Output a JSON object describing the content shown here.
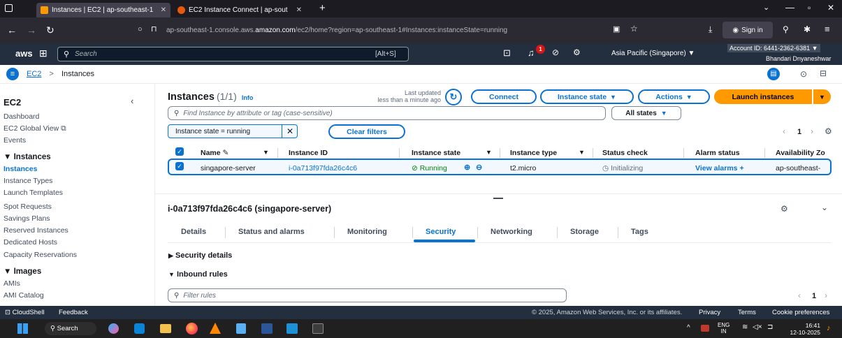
{
  "browser": {
    "tabs": [
      {
        "title": "Instances | EC2 | ap-southeast-1",
        "active": true
      },
      {
        "title": "EC2 Instance Connect | ap-sout",
        "active": false
      }
    ],
    "url_prefix": "ap-southeast-1.console.aws.",
    "url_domain": "amazon.com",
    "url_suffix": "/ec2/home?region=ap-southeast-1#Instances:instanceState=running",
    "sign_in": "Sign in"
  },
  "aws_nav": {
    "logo": "aws",
    "search_placeholder": "Search",
    "shortcut": "[Alt+S]",
    "notification_count": "1",
    "region": "Asia Pacific (Singapore) ▼",
    "account_id": "Account ID: 6441-2362-6381 ▼",
    "user": "Bhandari Dnyaneshwar"
  },
  "breadcrumb": {
    "service": "EC2",
    "separator": ">",
    "page": "Instances"
  },
  "sidebar": {
    "title": "EC2",
    "top_items": [
      "Dashboard",
      "EC2 Global View",
      "Events"
    ],
    "sections": [
      {
        "title": "Instances",
        "items": [
          "Instances",
          "Instance Types",
          "Launch Templates",
          "Spot Requests",
          "Savings Plans",
          "Reserved Instances",
          "Dedicated Hosts",
          "Capacity Reservations"
        ]
      },
      {
        "title": "Images",
        "items": [
          "AMIs",
          "AMI Catalog"
        ]
      }
    ]
  },
  "instances": {
    "title": "Instances",
    "count": "(1/1)",
    "info": "Info",
    "last_updated_label": "Last updated",
    "last_updated_value": "less than a minute ago",
    "connect": "Connect",
    "instance_state_btn": "Instance state",
    "actions_btn": "Actions",
    "launch_btn": "Launch instances",
    "search_placeholder": "Find Instance by attribute or tag (case-sensitive)",
    "states_filter": "All states",
    "filter_token": "Instance state = running",
    "clear_filters": "Clear filters",
    "page_number": "1",
    "columns": [
      "Name",
      "Instance ID",
      "Instance state",
      "Instance type",
      "Status check",
      "Alarm status",
      "Availability Zo"
    ],
    "row": {
      "name": "singapore-server",
      "id": "i-0a713f97fda26c4c6",
      "state": "Running",
      "type": "t2.micro",
      "status": "Initializing",
      "alarm": "View alarms",
      "az": "ap-southeast-"
    }
  },
  "details": {
    "title": "i-0a713f97fda26c4c6 (singapore-server)",
    "tabs": [
      "Details",
      "Status and alarms",
      "Monitoring",
      "Security",
      "Networking",
      "Storage",
      "Tags"
    ],
    "active_tab": "Security",
    "security_details": "Security details",
    "inbound_rules": "Inbound rules",
    "filter_placeholder": "Filter rules",
    "page_number": "1"
  },
  "footer": {
    "cloudshell": "CloudShell",
    "feedback": "Feedback",
    "copyright": "© 2025, Amazon Web Services, Inc. or its affiliates.",
    "privacy": "Privacy",
    "terms": "Terms",
    "cookies": "Cookie preferences"
  },
  "taskbar": {
    "search": "Search",
    "lang_top": "ENG",
    "lang_bottom": "IN",
    "time": "16:41",
    "date": "12-10-2025"
  },
  "colors": {
    "aws_dark": "#232f3e",
    "link_blue": "#0972d3",
    "orange": "#ff9900",
    "success": "#037f0c"
  }
}
